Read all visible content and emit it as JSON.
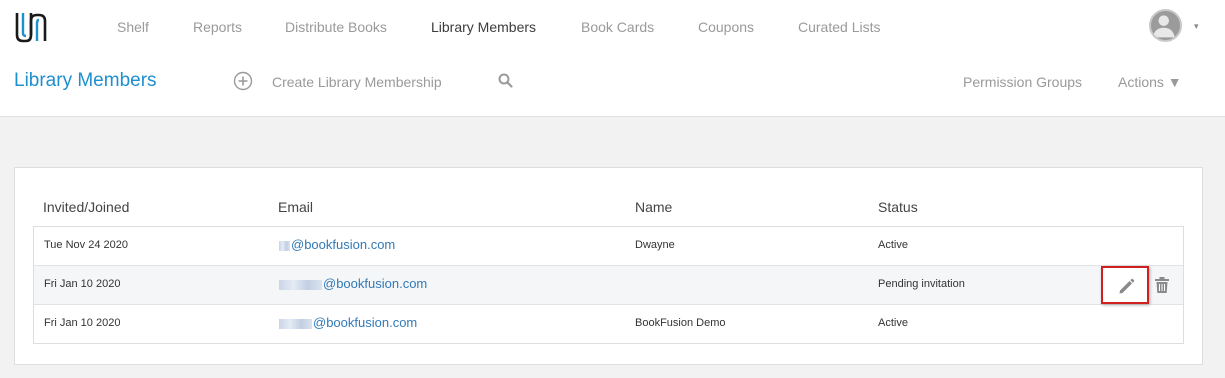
{
  "nav": {
    "items": [
      {
        "label": "Shelf"
      },
      {
        "label": "Reports"
      },
      {
        "label": "Distribute Books"
      },
      {
        "label": "Library Members"
      },
      {
        "label": "Book Cards"
      },
      {
        "label": "Coupons"
      },
      {
        "label": "Curated Lists"
      }
    ],
    "active": "Library Members",
    "avatar_caret": "▾"
  },
  "subheader": {
    "title": "Library Members",
    "create_label": "Create Library Membership",
    "permission_groups": "Permission Groups",
    "actions": "Actions ▼"
  },
  "table": {
    "headers": [
      "Invited/Joined",
      "Email",
      "Name",
      "Status"
    ],
    "rows": [
      {
        "date": "Tue Nov 24 2020",
        "email": "@bookfusion.com",
        "name": "Dwayne",
        "status": "Active"
      },
      {
        "date": "Fri Jan 10 2020",
        "email": "@bookfusion.com",
        "name": "",
        "status": "Pending invitation"
      },
      {
        "date": "Fri Jan 10 2020",
        "email": "@bookfusion.com",
        "name": "BookFusion Demo",
        "status": "Active"
      }
    ]
  },
  "colors": {
    "accent": "#1e8fcf",
    "link": "#3279b7",
    "highlight": "#d02020"
  },
  "icons": [
    "logo-icon",
    "avatar-icon",
    "plus-circle-icon",
    "search-icon",
    "pencil-icon",
    "trash-icon"
  ]
}
